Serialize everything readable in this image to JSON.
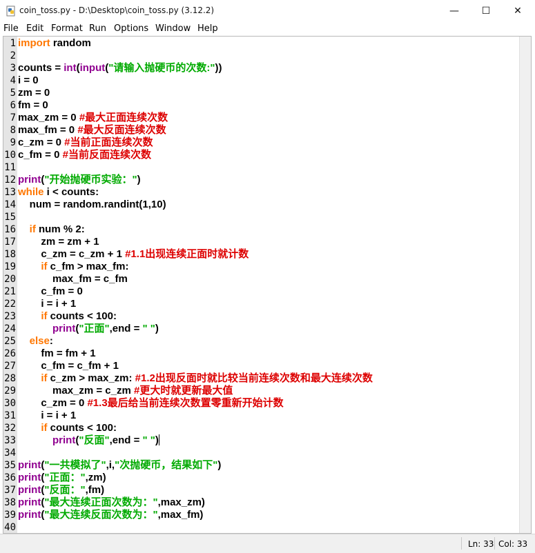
{
  "window": {
    "title": "coin_toss.py - D:\\Desktop\\coin_toss.py (3.12.2)",
    "minimize_glyph": "—",
    "maximize_glyph": "☐",
    "close_glyph": "✕",
    "app_icon": "python-file-icon"
  },
  "menu": [
    "File",
    "Edit",
    "Format",
    "Run",
    "Options",
    "Window",
    "Help"
  ],
  "colors": {
    "keyword": "#ff7700",
    "builtin": "#900090",
    "string": "#00aa00",
    "comment": "#dd0000",
    "gutter": "#e5e5e5"
  },
  "code_lines": [
    {
      "n": "1",
      "tokens": [
        [
          "k",
          "import"
        ],
        [
          "p",
          " random"
        ]
      ]
    },
    {
      "n": "2",
      "tokens": []
    },
    {
      "n": "3",
      "tokens": [
        [
          "p",
          "counts = "
        ],
        [
          "b",
          "int"
        ],
        [
          "p",
          "("
        ],
        [
          "b",
          "input"
        ],
        [
          "p",
          "("
        ],
        [
          "s",
          "\"请输入抛硬币的次数:\""
        ],
        [
          "p",
          "))"
        ]
      ]
    },
    {
      "n": "4",
      "tokens": [
        [
          "p",
          "i = 0"
        ]
      ]
    },
    {
      "n": "5",
      "tokens": [
        [
          "p",
          "zm = 0"
        ]
      ]
    },
    {
      "n": "6",
      "tokens": [
        [
          "p",
          "fm = 0"
        ]
      ]
    },
    {
      "n": "7",
      "tokens": [
        [
          "p",
          "max_zm = 0 "
        ],
        [
          "c",
          "#最大正面连续次数"
        ]
      ]
    },
    {
      "n": "8",
      "tokens": [
        [
          "p",
          "max_fm = 0 "
        ],
        [
          "c",
          "#最大反面连续次数"
        ]
      ]
    },
    {
      "n": "9",
      "tokens": [
        [
          "p",
          "c_zm = 0 "
        ],
        [
          "c",
          "#当前正面连续次数"
        ]
      ]
    },
    {
      "n": "10",
      "tokens": [
        [
          "p",
          "c_fm = 0 "
        ],
        [
          "c",
          "#当前反面连续次数"
        ]
      ]
    },
    {
      "n": "11",
      "tokens": []
    },
    {
      "n": "12",
      "tokens": [
        [
          "b",
          "print"
        ],
        [
          "p",
          "("
        ],
        [
          "s",
          "\"开始抛硬币实验：\""
        ],
        [
          "p",
          ")"
        ]
      ]
    },
    {
      "n": "13",
      "tokens": [
        [
          "k",
          "while"
        ],
        [
          "p",
          " i < counts:"
        ]
      ]
    },
    {
      "n": "14",
      "tokens": [
        [
          "p",
          "    num = random.randint(1,10)"
        ]
      ]
    },
    {
      "n": "15",
      "tokens": []
    },
    {
      "n": "16",
      "tokens": [
        [
          "p",
          "    "
        ],
        [
          "k",
          "if"
        ],
        [
          "p",
          " num % 2:"
        ]
      ]
    },
    {
      "n": "17",
      "tokens": [
        [
          "p",
          "        zm = zm + 1"
        ]
      ]
    },
    {
      "n": "18",
      "tokens": [
        [
          "p",
          "        c_zm = c_zm + 1 "
        ],
        [
          "c",
          "#1.1出现连续正面时就计数"
        ]
      ]
    },
    {
      "n": "19",
      "tokens": [
        [
          "p",
          "        "
        ],
        [
          "k",
          "if"
        ],
        [
          "p",
          " c_fm > max_fm:"
        ]
      ]
    },
    {
      "n": "20",
      "tokens": [
        [
          "p",
          "            max_fm = c_fm"
        ]
      ]
    },
    {
      "n": "21",
      "tokens": [
        [
          "p",
          "        c_fm = 0"
        ]
      ]
    },
    {
      "n": "22",
      "tokens": [
        [
          "p",
          "        i = i + 1"
        ]
      ]
    },
    {
      "n": "23",
      "tokens": [
        [
          "p",
          "        "
        ],
        [
          "k",
          "if"
        ],
        [
          "p",
          " counts < 100:"
        ]
      ]
    },
    {
      "n": "24",
      "tokens": [
        [
          "p",
          "            "
        ],
        [
          "b",
          "print"
        ],
        [
          "p",
          "("
        ],
        [
          "s",
          "\"正面\""
        ],
        [
          "p",
          ",end = "
        ],
        [
          "s",
          "\" \""
        ],
        [
          "p",
          ")"
        ]
      ]
    },
    {
      "n": "25",
      "tokens": [
        [
          "p",
          "    "
        ],
        [
          "k",
          "else"
        ],
        [
          "p",
          ":"
        ]
      ]
    },
    {
      "n": "26",
      "tokens": [
        [
          "p",
          "        fm = fm + 1"
        ]
      ]
    },
    {
      "n": "27",
      "tokens": [
        [
          "p",
          "        c_fm = c_fm + 1"
        ]
      ]
    },
    {
      "n": "28",
      "tokens": [
        [
          "p",
          "        "
        ],
        [
          "k",
          "if"
        ],
        [
          "p",
          " c_zm > max_zm: "
        ],
        [
          "c",
          "#1.2出现反面时就比较当前连续次数和最大连续次数"
        ]
      ]
    },
    {
      "n": "29",
      "tokens": [
        [
          "p",
          "            max_zm = c_zm "
        ],
        [
          "c",
          "#更大时就更新最大值"
        ]
      ]
    },
    {
      "n": "30",
      "tokens": [
        [
          "p",
          "        c_zm = 0 "
        ],
        [
          "c",
          "#1.3最后给当前连续次数置零重新开始计数"
        ]
      ]
    },
    {
      "n": "31",
      "tokens": [
        [
          "p",
          "        i = i + 1"
        ]
      ]
    },
    {
      "n": "32",
      "tokens": [
        [
          "p",
          "        "
        ],
        [
          "k",
          "if"
        ],
        [
          "p",
          " counts < 100:"
        ]
      ]
    },
    {
      "n": "33",
      "tokens": [
        [
          "p",
          "            "
        ],
        [
          "b",
          "print"
        ],
        [
          "p",
          "("
        ],
        [
          "s",
          "\"反面\""
        ],
        [
          "p",
          ",end = "
        ],
        [
          "s",
          "\" \""
        ],
        [
          "p",
          ")"
        ]
      ],
      "cursor": true
    },
    {
      "n": "34",
      "tokens": []
    },
    {
      "n": "35",
      "tokens": [
        [
          "b",
          "print"
        ],
        [
          "p",
          "("
        ],
        [
          "s",
          "\"一共模拟了\""
        ],
        [
          "p",
          ",i,"
        ],
        [
          "s",
          "\"次抛硬币，结果如下\""
        ],
        [
          "p",
          ")"
        ]
      ]
    },
    {
      "n": "36",
      "tokens": [
        [
          "b",
          "print"
        ],
        [
          "p",
          "("
        ],
        [
          "s",
          "\"正面：\""
        ],
        [
          "p",
          ",zm)"
        ]
      ]
    },
    {
      "n": "37",
      "tokens": [
        [
          "b",
          "print"
        ],
        [
          "p",
          "("
        ],
        [
          "s",
          "\"反面：\""
        ],
        [
          "p",
          ",fm)"
        ]
      ]
    },
    {
      "n": "38",
      "tokens": [
        [
          "b",
          "print"
        ],
        [
          "p",
          "("
        ],
        [
          "s",
          "\"最大连续正面次数为：\""
        ],
        [
          "p",
          ",max_zm)"
        ]
      ]
    },
    {
      "n": "39",
      "tokens": [
        [
          "b",
          "print"
        ],
        [
          "p",
          "("
        ],
        [
          "s",
          "\"最大连续反面次数为：\""
        ],
        [
          "p",
          ",max_fm)"
        ]
      ]
    },
    {
      "n": "40",
      "tokens": []
    }
  ],
  "status": {
    "line": "Ln: 33",
    "col": "Col: 33"
  }
}
